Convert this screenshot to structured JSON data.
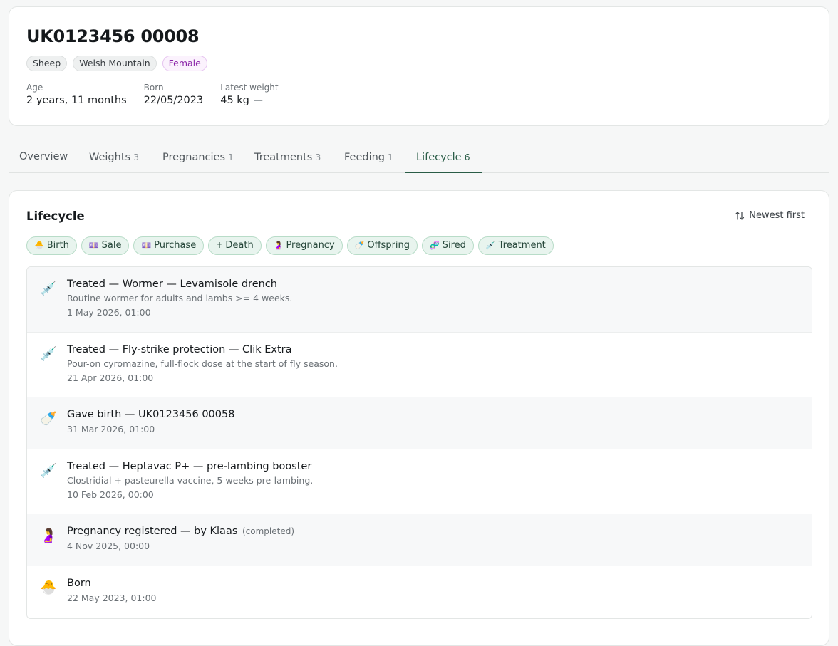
{
  "animal": {
    "id": "UK0123456 00008",
    "badges": {
      "species": "Sheep",
      "breed": "Welsh Mountain",
      "sex": "Female"
    },
    "stats": {
      "age_label": "Age",
      "age_value": "2 years, 11 months",
      "born_label": "Born",
      "born_value": "22/05/2023",
      "weight_label": "Latest weight",
      "weight_value": "45 kg",
      "weight_trend": "—"
    }
  },
  "tabs": [
    {
      "label": "Overview",
      "count": ""
    },
    {
      "label": "Weights",
      "count": "3"
    },
    {
      "label": "Pregnancies",
      "count": "1"
    },
    {
      "label": "Treatments",
      "count": "3"
    },
    {
      "label": "Feeding",
      "count": "1"
    },
    {
      "label": "Lifecycle",
      "count": "6"
    }
  ],
  "lifecycle": {
    "title": "Lifecycle",
    "sort_label": "Newest first",
    "filters": [
      {
        "icon": "🐣",
        "label": "Birth"
      },
      {
        "icon": "💷",
        "label": "Sale"
      },
      {
        "icon": "💷",
        "label": "Purchase"
      },
      {
        "icon": "✝",
        "label": "Death"
      },
      {
        "icon": "🤰",
        "label": "Pregnancy"
      },
      {
        "icon": "🍼",
        "label": "Offspring"
      },
      {
        "icon": "🧬",
        "label": "Sired"
      },
      {
        "icon": "💉",
        "label": "Treatment"
      }
    ],
    "events": [
      {
        "icon": "💉",
        "title": "Treated — Wormer — Levamisole drench",
        "note": "",
        "desc": "Routine wormer for adults and lambs >= 4 weeks.",
        "time": "1 May 2026, 01:00"
      },
      {
        "icon": "💉",
        "title": "Treated — Fly-strike protection — Clik Extra",
        "note": "",
        "desc": "Pour-on cyromazine, full-flock dose at the start of fly season.",
        "time": "21 Apr 2026, 01:00"
      },
      {
        "icon": "🍼",
        "title": "Gave birth — UK0123456 00058",
        "note": "",
        "desc": "",
        "time": "31 Mar 2026, 01:00"
      },
      {
        "icon": "💉",
        "title": "Treated — Heptavac P+ — pre-lambing booster",
        "note": "",
        "desc": "Clostridial + pasteurella vaccine, 5 weeks pre-lambing.",
        "time": "10 Feb 2026, 00:00"
      },
      {
        "icon": "🤰",
        "title": "Pregnancy registered — by Klaas",
        "note": "(completed)",
        "desc": "",
        "time": "4 Nov 2025, 00:00"
      },
      {
        "icon": "🐣",
        "title": "Born",
        "note": "",
        "desc": "",
        "time": "22 May 2023, 01:00"
      }
    ]
  },
  "colors": {
    "accent": "#2a5d47",
    "chip_bg": "#e8f4ee",
    "female_badge": "#8a23a8"
  }
}
